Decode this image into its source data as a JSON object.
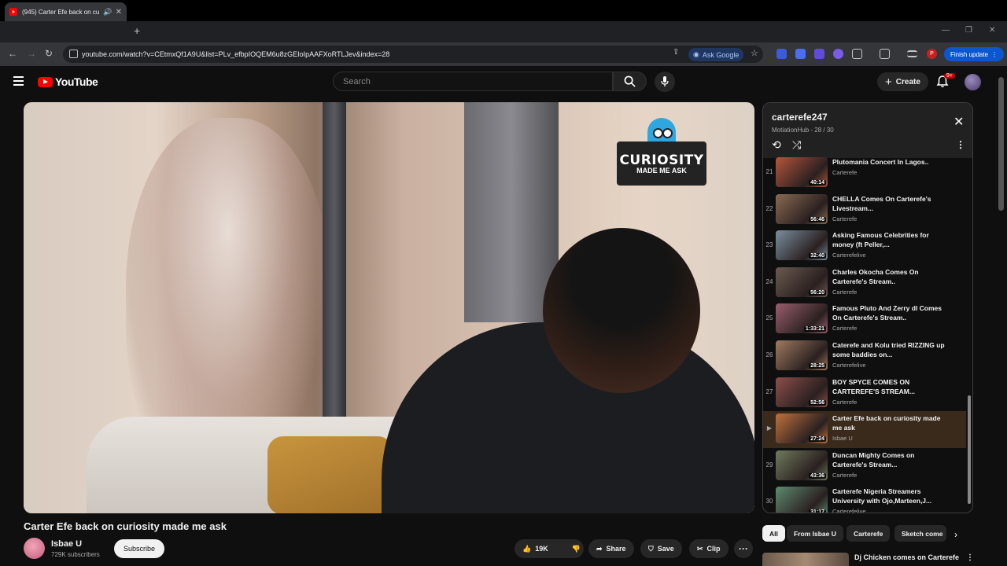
{
  "browser": {
    "tab_title": "(945) Carter Efe back on cu",
    "url": "youtube.com/watch?v=CEtmxQf1A9U&list=PLv_efbpIOQEM6u8zGEIoIpAAFXoRTLJev&index=28",
    "ask_google": "Ask Google",
    "finish_update": "Finish update",
    "profile_initial": "P"
  },
  "header": {
    "logo": "YouTube",
    "search_placeholder": "Search",
    "create_label": "Create",
    "notifications_badge": "9+"
  },
  "video": {
    "overlay_main": "CURIOSITY",
    "overlay_sub": "MADE ME ASK",
    "title": "Carter Efe back on curiosity made me ask"
  },
  "channel": {
    "name": "Isbae U",
    "subscribers": "729K subscribers",
    "subscribe_label": "Subscribe"
  },
  "actions": {
    "likes": "19K",
    "share": "Share",
    "save": "Save",
    "clip": "Clip"
  },
  "playlist": {
    "title": "carterefe247",
    "subtitle": "MotiationHub - 28 / 30",
    "items": [
      {
        "index": "21",
        "title": "Plutomania Concert In Lagos..",
        "channel": "Carterefe",
        "duration": "40:14",
        "color": "#b4553a"
      },
      {
        "index": "22",
        "title": "CHELLA Comes On Carterefe's Livestream...",
        "channel": "Carterefe",
        "duration": "56:46",
        "color": "#8a6a52"
      },
      {
        "index": "23",
        "title": "Asking Famous Celebrities for money (ft Peller,...",
        "channel": "Carterefelive",
        "duration": "32:40",
        "color": "#7a8fa0"
      },
      {
        "index": "24",
        "title": "Charles Okocha Comes On Carterefe's Stream..",
        "channel": "Carterefe",
        "duration": "56:20",
        "color": "#6b5a50"
      },
      {
        "index": "25",
        "title": "Famous Pluto And Zerry dl Comes On Carterefe's Stream..",
        "channel": "Carterefe",
        "duration": "1:33:21",
        "color": "#9a5e6e"
      },
      {
        "index": "26",
        "title": "Caterefe and Kolu tried RIZZING up some baddies on...",
        "channel": "Carterefelive",
        "duration": "28:25",
        "color": "#a07a60"
      },
      {
        "index": "27",
        "title": "BOY SPYCE COMES ON CARTEREFE'S STREAM...",
        "channel": "Carterefe",
        "duration": "52:56",
        "color": "#8d4e4a"
      },
      {
        "index": "▶",
        "title": "Carter Efe back on curiosity made me ask",
        "channel": "Isbae U",
        "duration": "27:24",
        "color": "#c0713c",
        "active": true
      },
      {
        "index": "29",
        "title": "Duncan Mighty Comes on Carterefe's Stream...",
        "channel": "Carterefe",
        "duration": "43:36",
        "color": "#6f7a5c"
      },
      {
        "index": "30",
        "title": "Carterefe Nigeria Streamers University with Ojo,Marteen,J...",
        "channel": "Carterefelive",
        "duration": "31:17",
        "color": "#5e8a70"
      }
    ]
  },
  "chips": [
    "All",
    "From Isbae U",
    "Carterefe",
    "Sketch come"
  ],
  "recommendation": {
    "title": "Dj Chicken comes on Carterefe"
  }
}
